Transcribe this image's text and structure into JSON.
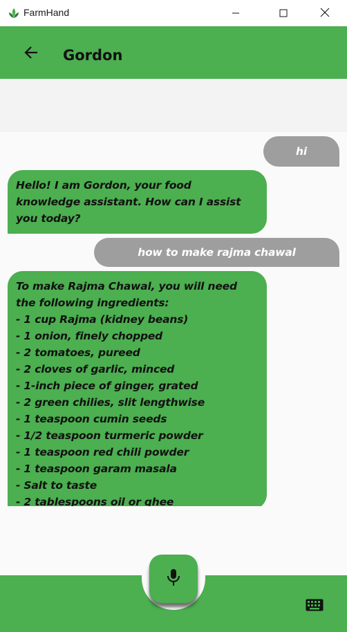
{
  "window": {
    "title": "FarmHand",
    "minimize_icon": "minimize-icon",
    "maximize_icon": "maximize-icon",
    "close_icon": "close-icon"
  },
  "appbar": {
    "back_icon": "arrow-left-icon",
    "title": "Gordon"
  },
  "messages": [
    {
      "role": "user",
      "text": "hi"
    },
    {
      "role": "assistant",
      "text": "Hello! I am Gordon, your food knowledge assistant. How can I assist you today?"
    },
    {
      "role": "user",
      "text": "how to make rajma chawal"
    },
    {
      "role": "assistant",
      "text": "To make Rajma Chawal, you will need the following ingredients:\n- 1 cup Rajma (kidney beans)\n- 1 onion, finely chopped\n- 2 tomatoes, pureed\n- 2 cloves of garlic, minced\n- 1-inch piece of ginger, grated\n- 2 green chilies, slit lengthwise\n- 1 teaspoon cumin seeds\n- 1/2 teaspoon turmeric powder\n- 1 teaspoon red chili powder\n- 1 teaspoon garam masala\n- Salt to taste\n- 2 tablespoons oil or ghee"
    }
  ],
  "bottombar": {
    "mic_icon": "microphone-icon",
    "keyboard_icon": "keyboard-icon"
  },
  "colors": {
    "accent": "#4caf50",
    "user_bubble": "#9e9e9e",
    "background": "#fafafa"
  }
}
